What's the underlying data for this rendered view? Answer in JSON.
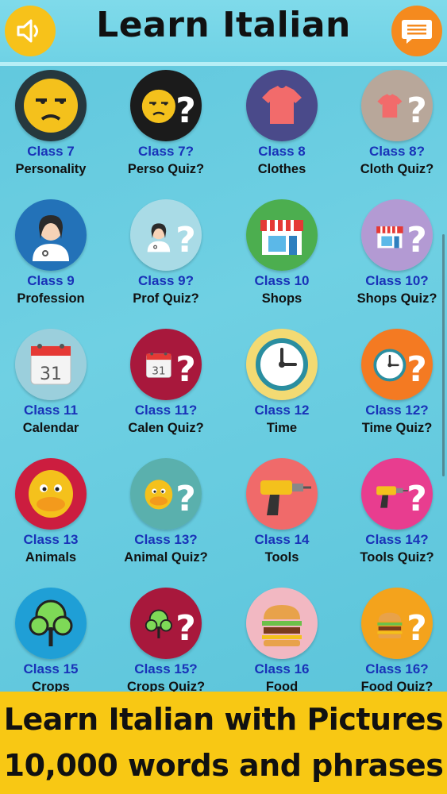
{
  "header": {
    "title": "Learn Italian",
    "sound_icon": "speaker-icon",
    "chat_icon": "chat-bubble-icon"
  },
  "classes": [
    {
      "class_label": "Class 7",
      "name": "Personality",
      "icon": "annoyed-face-icon",
      "bg": "#26383e"
    },
    {
      "class_label": "Class 7?",
      "name": "Perso Quiz?",
      "icon": "annoyed-face-quiz-icon",
      "bg": "#1b1b1b"
    },
    {
      "class_label": "Class 8",
      "name": "Clothes",
      "icon": "tshirt-icon",
      "bg": "#4a4a8a"
    },
    {
      "class_label": "Class 8?",
      "name": "Cloth Quiz?",
      "icon": "tshirt-quiz-icon",
      "bg": "#b8a79a"
    },
    {
      "class_label": "Class 9",
      "name": "Profession",
      "icon": "doctor-icon",
      "bg": "#2372b8"
    },
    {
      "class_label": "Class 9?",
      "name": "Prof Quiz?",
      "icon": "doctor-quiz-icon",
      "bg": "#a9dbe6"
    },
    {
      "class_label": "Class 10",
      "name": "Shops",
      "icon": "shop-icon",
      "bg": "#4cae4f"
    },
    {
      "class_label": "Class 10?",
      "name": "Shops Quiz?",
      "icon": "shop-quiz-icon",
      "bg": "#b39ad3"
    },
    {
      "class_label": "Class 11",
      "name": "Calendar",
      "icon": "calendar-icon",
      "bg": "#9bcfdc"
    },
    {
      "class_label": "Class 11?",
      "name": "Calen Quiz?",
      "icon": "calendar-quiz-icon",
      "bg": "#a8183c"
    },
    {
      "class_label": "Class 12",
      "name": "Time",
      "icon": "clock-icon",
      "bg": "#f3da73"
    },
    {
      "class_label": "Class 12?",
      "name": "Time Quiz?",
      "icon": "clock-quiz-icon",
      "bg": "#f47a22"
    },
    {
      "class_label": "Class 13",
      "name": "Animals",
      "icon": "duck-icon",
      "bg": "#cc1d3f"
    },
    {
      "class_label": "Class 13?",
      "name": "Animal Quiz?",
      "icon": "duck-quiz-icon",
      "bg": "#5ab0ad"
    },
    {
      "class_label": "Class 14",
      "name": "Tools",
      "icon": "drill-icon",
      "bg": "#f06a6a"
    },
    {
      "class_label": "Class 14?",
      "name": "Tools Quiz?",
      "icon": "drill-quiz-icon",
      "bg": "#e83d8f"
    },
    {
      "class_label": "Class 15",
      "name": "Crops",
      "icon": "tree-icon",
      "bg": "#1f9fd6"
    },
    {
      "class_label": "Class 15?",
      "name": "Crops Quiz?",
      "icon": "tree-quiz-icon",
      "bg": "#a8183c"
    },
    {
      "class_label": "Class 16",
      "name": "Food",
      "icon": "burger-icon",
      "bg": "#f2b8c2"
    },
    {
      "class_label": "Class 16?",
      "name": "Food Quiz?",
      "icon": "burger-quiz-icon",
      "bg": "#f4a31c"
    }
  ],
  "banner": {
    "line1": "Learn Italian with Pictures",
    "line2": "10,000 words and phrases"
  }
}
